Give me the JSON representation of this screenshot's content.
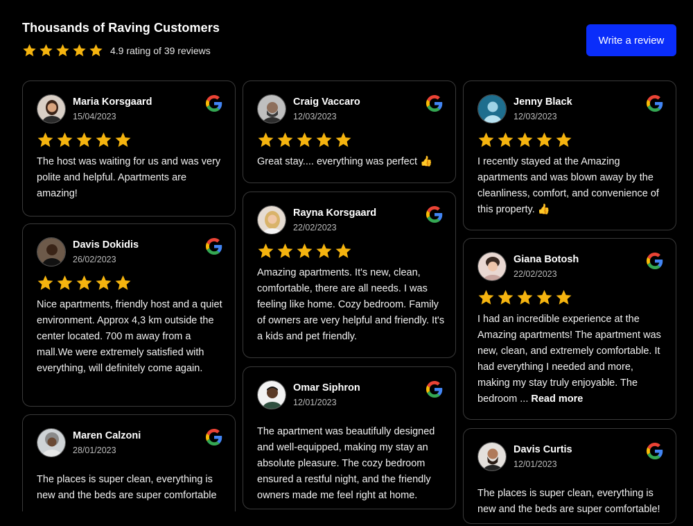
{
  "header": {
    "title": "Thousands of Raving Customers",
    "rating_text": "4.9 rating of 39 reviews",
    "stars": 5,
    "write_review_label": "Write a review"
  },
  "colors": {
    "accent": "#0a2dfa",
    "star": "#f5b40f",
    "background": "#000000",
    "card_border": "#3a3a3a"
  },
  "reviews": [
    {
      "name": "Maria Korsgaard",
      "date": "15/04/2023",
      "stars": 5,
      "text": "The host was waiting for us and was very polite and helpful. Apartments are amazing!",
      "source_icon": "google-icon"
    },
    {
      "name": "Davis Dokidis",
      "date": "26/02/2023",
      "stars": 5,
      "text": "Nice apartments, friendly host and a quiet environment. Approx 4,3 km outside the center located. 700 m away from a mall.We were extremely satisfied with everything, will definitely come again.",
      "source_icon": "google-icon"
    },
    {
      "name": "Maren Calzoni",
      "date": "28/01/2023",
      "text": "The places is super clean, everything is new and the beds are super comfortable",
      "source_icon": "google-icon"
    },
    {
      "name": "Craig Vaccaro",
      "date": "12/03/2023",
      "stars": 5,
      "text": "Great stay.... everything was perfect 👍",
      "source_icon": "google-icon"
    },
    {
      "name": "Rayna Korsgaard",
      "date": "22/02/2023",
      "stars": 5,
      "text": "Amazing apartments. It's new, clean, comfortable, there are all needs. I was feeling like home. Cozy bedroom. Family of owners are very helpful and friendly. It's a kids and pet friendly.",
      "source_icon": "google-icon"
    },
    {
      "name": "Omar Siphron",
      "date": "12/01/2023",
      "text": "The apartment was beautifully designed and well-equipped, making my stay an absolute pleasure. The cozy bedroom ensured a restful night, and the friendly owners made me feel right at home.",
      "source_icon": "google-icon"
    },
    {
      "name": "Jenny Black",
      "date": "12/03/2023",
      "stars": 5,
      "text": "I recently stayed at the Amazing apartments and was blown away by the cleanliness, comfort, and convenience of this property. 👍",
      "source_icon": "google-icon"
    },
    {
      "name": "Giana Botosh",
      "date": "22/02/2023",
      "stars": 5,
      "text": "I had an incredible experience at the Amazing apartments! The apartment was new, clean, and extremely comfortable. It had everything I needed and more, making my stay truly enjoyable. The bedroom  ...",
      "read_more": "Read more",
      "source_icon": "google-icon"
    },
    {
      "name": "Davis Curtis",
      "date": "12/01/2023",
      "text": "The places is super clean, everything is new and the beds are super comfortable!",
      "source_icon": "google-icon"
    }
  ]
}
